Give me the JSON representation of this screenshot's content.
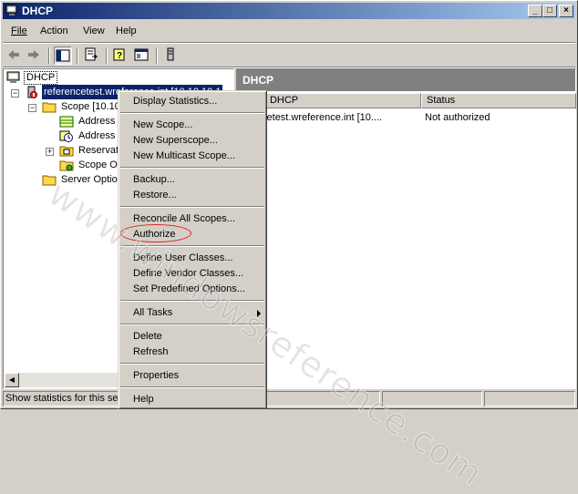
{
  "window": {
    "title": "DHCP",
    "minimize": "_",
    "maximize": "□",
    "close": "×"
  },
  "menu": {
    "file": "File",
    "action": "Action",
    "view": "View",
    "help": "Help"
  },
  "tree": {
    "root": "DHCP",
    "server": "referencetest.wreference.int [10.10.10.1",
    "scope": "Scope [10.10",
    "address_pool": "Address",
    "address_leases": "Address",
    "reservations": "Reservat",
    "scope_options": "Scope Op",
    "server_options": "Server Optio"
  },
  "right_pane": {
    "header": "DHCP",
    "columns": [
      "Contents of DHCP",
      "Status"
    ],
    "column_visible": [
      "nts of DHCP",
      "Status"
    ],
    "rows": [
      {
        "name": "erencetest.wreference.int [10....",
        "status": "Not authorized"
      }
    ]
  },
  "context_menu": {
    "display_statistics": "Display Statistics...",
    "new_scope": "New Scope...",
    "new_superscope": "New Superscope...",
    "new_multicast_scope": "New Multicast Scope...",
    "backup": "Backup...",
    "restore": "Restore...",
    "reconcile": "Reconcile All Scopes...",
    "authorize": "Authorize",
    "define_user_classes": "Define User Classes...",
    "define_vendor_classes": "Define Vendor Classes...",
    "set_predefined_options": "Set Predefined Options...",
    "all_tasks": "All Tasks",
    "delete": "Delete",
    "refresh": "Refresh",
    "properties": "Properties",
    "help": "Help"
  },
  "status_bar": {
    "text": "Show statistics for this ser"
  },
  "watermark": "www.windowsreference.com",
  "colors": {
    "title_start": "#0a246a",
    "title_end": "#a6caf0",
    "selection": "#0a246a",
    "highlight_oval": "#e02020"
  }
}
